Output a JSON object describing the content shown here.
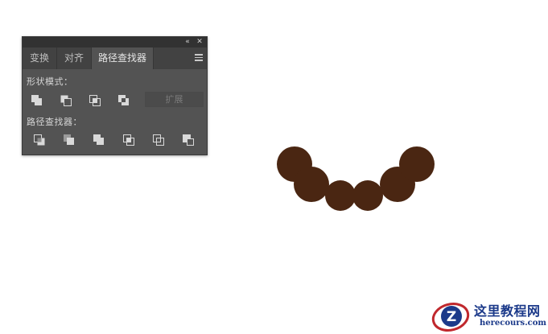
{
  "panel": {
    "collapse_icon": "«",
    "close_icon": "✕",
    "tabs": [
      {
        "label": "变换",
        "active": false
      },
      {
        "label": "对齐",
        "active": false
      },
      {
        "label": "路径查找器",
        "active": true
      }
    ],
    "shape_modes_label": "形状模式：",
    "expand_label": "扩展",
    "pathfinders_label": "路径查找器：",
    "shape_mode_icons": [
      "unite-icon",
      "minus-front-icon",
      "intersect-icon",
      "exclude-icon"
    ],
    "pathfinder_icons": [
      "divide-icon",
      "trim-icon",
      "merge-icon",
      "crop-icon",
      "outline-icon",
      "minus-back-icon"
    ]
  },
  "artwork": {
    "shape": "brown circles arranged in a smile curve",
    "fill_color": "#4a2612",
    "circle_count": 6
  },
  "watermark": {
    "title": "这里教程网",
    "url": "herecours.com",
    "colors": {
      "blue": "#1c3a8a",
      "red": "#c0282d"
    }
  }
}
